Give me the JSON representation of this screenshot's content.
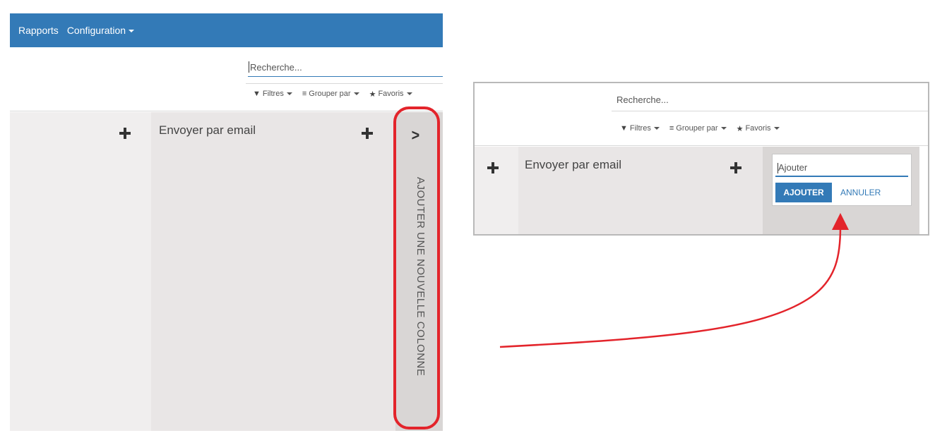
{
  "left_view": {
    "topbar": {
      "items": [
        {
          "label": "Rapports"
        },
        {
          "label": "Configuration"
        }
      ]
    },
    "search": {
      "placeholder": "Recherche..."
    },
    "filters": {
      "filters_label": "Filtres",
      "group_by_label": "Grouper par",
      "favorites_label": "Favoris"
    },
    "columns": {
      "email_column_title": "Envoyer par email",
      "add_column_label": "AJOUTER UNE NOUVELLE COLONNE"
    }
  },
  "right_view": {
    "search": {
      "placeholder": "Recherche..."
    },
    "filters": {
      "filters_label": "Filtres",
      "group_by_label": "Grouper par",
      "favorites_label": "Favoris"
    },
    "columns": {
      "email_column_title": "Envoyer par email"
    },
    "quick_add": {
      "input_placeholder": "Ajouter",
      "add_button_label": "AJOUTER",
      "cancel_link_label": "ANNULER"
    }
  },
  "colors": {
    "brand_blue": "#337ab7",
    "highlight_red": "#e3242b"
  },
  "icons": {
    "filter": "funnel-icon",
    "group_by": "list-icon",
    "favorites": "star-icon",
    "add_column": "chevron-right-icon",
    "add_record": "plus-icon"
  }
}
